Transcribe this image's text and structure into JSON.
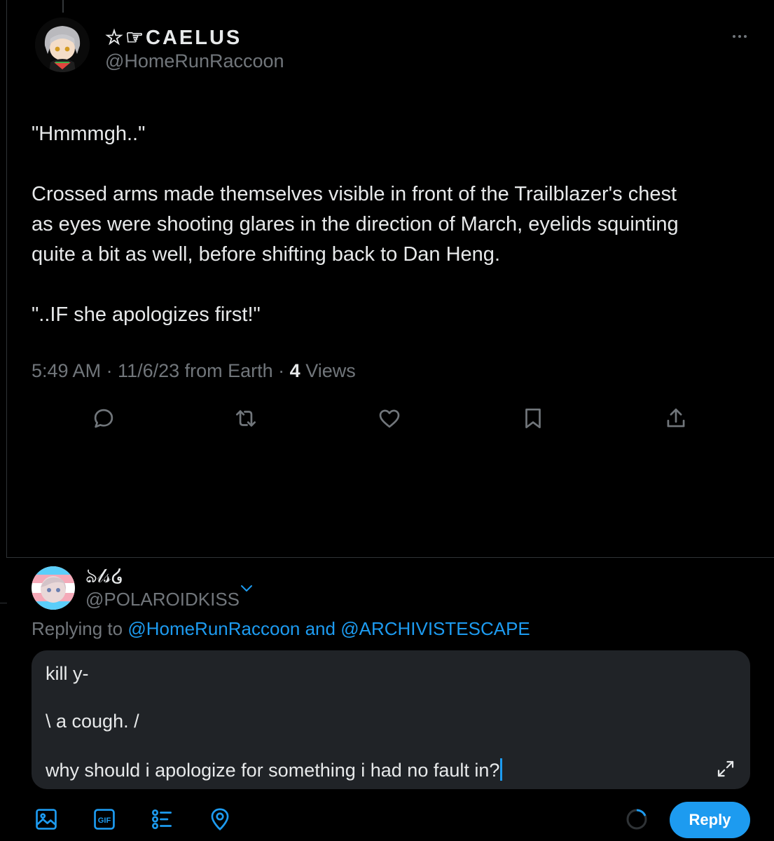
{
  "tweet": {
    "author": {
      "display_name": "☆☞CAELUS",
      "handle": "@HomeRunRaccoon"
    },
    "body": "\"Hmmmgh..\"\n\nCrossed arms made themselves visible in front of the Trailblazer's chest\nas eyes were shooting glares in the direction of March, eyelids squinting\nquite a bit as well, before shifting back to Dan Heng.\n\n\"..IF she apologizes first!\"",
    "meta_prefix": "5:49 AM · 11/6/23 from Earth · ",
    "views_count": "4",
    "views_label": " Views",
    "actions": [
      {
        "name": "reply-icon"
      },
      {
        "name": "retweet-icon"
      },
      {
        "name": "like-icon"
      },
      {
        "name": "bookmark-icon"
      },
      {
        "name": "share-icon"
      }
    ]
  },
  "reply_composer": {
    "account": {
      "display_name": "ঌ𝓁𝓈໒",
      "handle": "@POLAROIDKISS"
    },
    "replying_prefix": "Replying to ",
    "replying_user1": "@HomeRunRaccoon",
    "replying_and": " and ",
    "replying_user2": "@ARCHIVISTESCAPE",
    "draft_lines": [
      "kill y-",
      "\\ a cough. /",
      "why should i apologize for something i had no fault in?"
    ],
    "toolbar": [
      "image-icon",
      "gif-icon",
      "poll-icon",
      "location-icon"
    ],
    "reply_button": "Reply"
  },
  "colors": {
    "background": "#000000",
    "text": "#e7e9ea",
    "secondary_text": "#71767b",
    "accent": "#1d9bf0",
    "composer_bg": "#202327"
  }
}
